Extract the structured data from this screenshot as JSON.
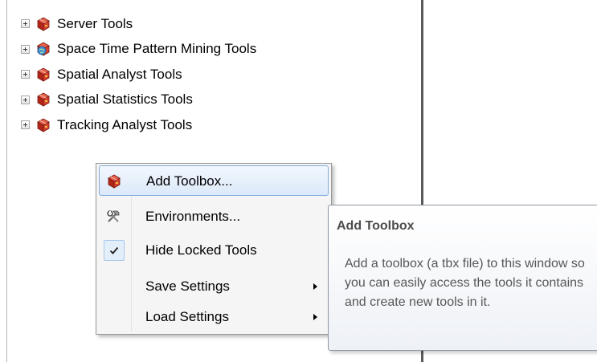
{
  "tree": {
    "items": [
      {
        "label": "Server Tools",
        "icon": "toolbox-icon"
      },
      {
        "label": "Space Time Pattern Mining Tools",
        "icon": "toolbox-globe-icon"
      },
      {
        "label": "Spatial Analyst Tools",
        "icon": "toolbox-icon"
      },
      {
        "label": "Spatial Statistics Tools",
        "icon": "toolbox-icon"
      },
      {
        "label": "Tracking Analyst Tools",
        "icon": "toolbox-icon"
      }
    ]
  },
  "context_menu": {
    "items": [
      {
        "label": "Add Toolbox...",
        "icon": "toolbox-icon",
        "highlighted": true
      },
      {
        "label": "Environments...",
        "icon": "hammer-wrench-icon"
      },
      {
        "label": "Hide Locked Tools",
        "icon": "checkmark-icon",
        "checked": true
      },
      {
        "label": "Save Settings",
        "icon": "submenu-arrow-icon"
      },
      {
        "label": "Load Settings",
        "icon": "submenu-arrow-icon"
      }
    ]
  },
  "tooltip": {
    "title": "Add Toolbox",
    "body": "Add a toolbox (a tbx file) to this window so you can easily access the tools it contains and create new tools in it."
  },
  "colors": {
    "highlight_border": "#84acdd",
    "toolbox_red": "#c0392b"
  }
}
